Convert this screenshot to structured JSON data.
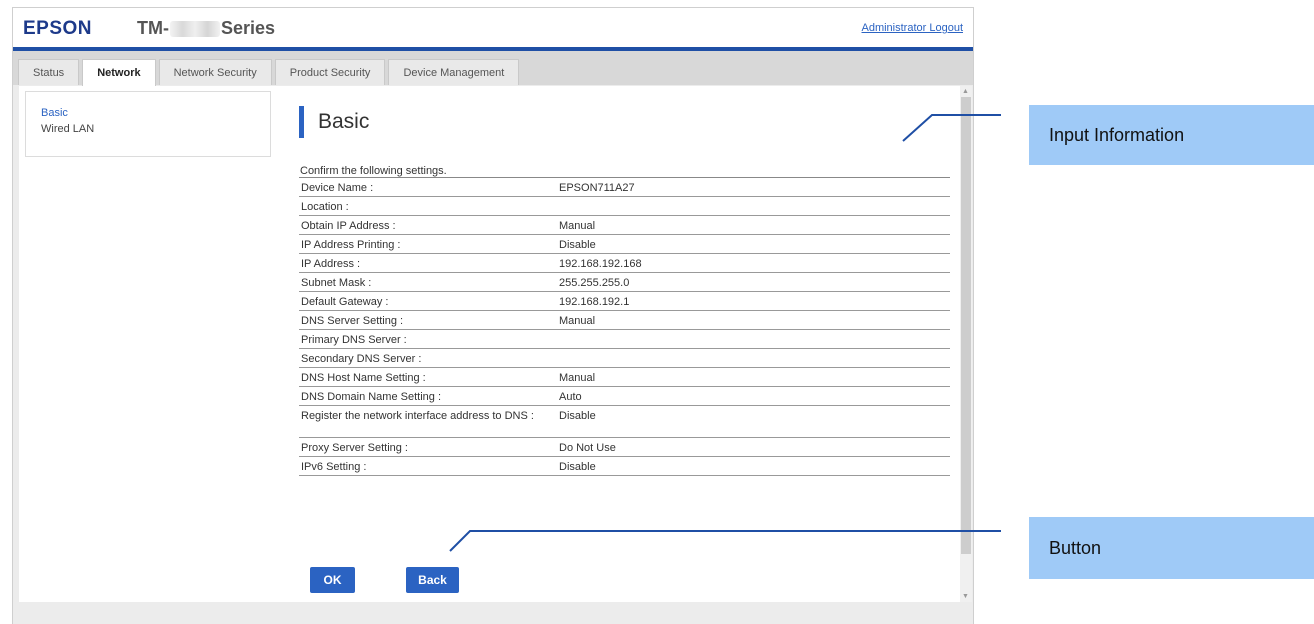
{
  "header": {
    "logo": "EPSON",
    "model_prefix": "TM-",
    "model_suffix": "Series",
    "logout": "Administrator Logout"
  },
  "tabs": [
    {
      "label": "Status"
    },
    {
      "label": "Network"
    },
    {
      "label": "Network Security"
    },
    {
      "label": "Product Security"
    },
    {
      "label": "Device Management"
    }
  ],
  "sidebar": {
    "items": [
      {
        "label": "Basic"
      },
      {
        "label": "Wired LAN"
      }
    ]
  },
  "main": {
    "title": "Basic",
    "confirm_text": "Confirm the following settings.",
    "rows": [
      {
        "key": "Device Name :",
        "value": "EPSON711A27"
      },
      {
        "key": "Location :",
        "value": ""
      },
      {
        "key": "Obtain IP Address :",
        "value": "Manual"
      },
      {
        "key": "IP Address Printing :",
        "value": "Disable"
      },
      {
        "key": "IP Address :",
        "value": "192.168.192.168"
      },
      {
        "key": "Subnet Mask :",
        "value": "255.255.255.0"
      },
      {
        "key": "Default Gateway :",
        "value": "192.168.192.1"
      },
      {
        "key": "DNS Server Setting :",
        "value": "Manual"
      },
      {
        "key": "Primary DNS Server :",
        "value": ""
      },
      {
        "key": "Secondary DNS Server :",
        "value": ""
      },
      {
        "key": "DNS Host Name Setting :",
        "value": "Manual"
      },
      {
        "key": "DNS Domain Name Setting :",
        "value": "Auto"
      },
      {
        "key": "Register the network interface address to DNS :",
        "value": "Disable"
      },
      {
        "key": "Proxy Server Setting :",
        "value": "Do Not Use"
      },
      {
        "key": "IPv6 Setting :",
        "value": "Disable"
      }
    ],
    "ok_label": "OK",
    "back_label": "Back"
  },
  "callouts": {
    "info": "Input Information",
    "button": "Button"
  },
  "colors": {
    "accent": "#2b63c2",
    "callout": "#9fcaf7"
  }
}
